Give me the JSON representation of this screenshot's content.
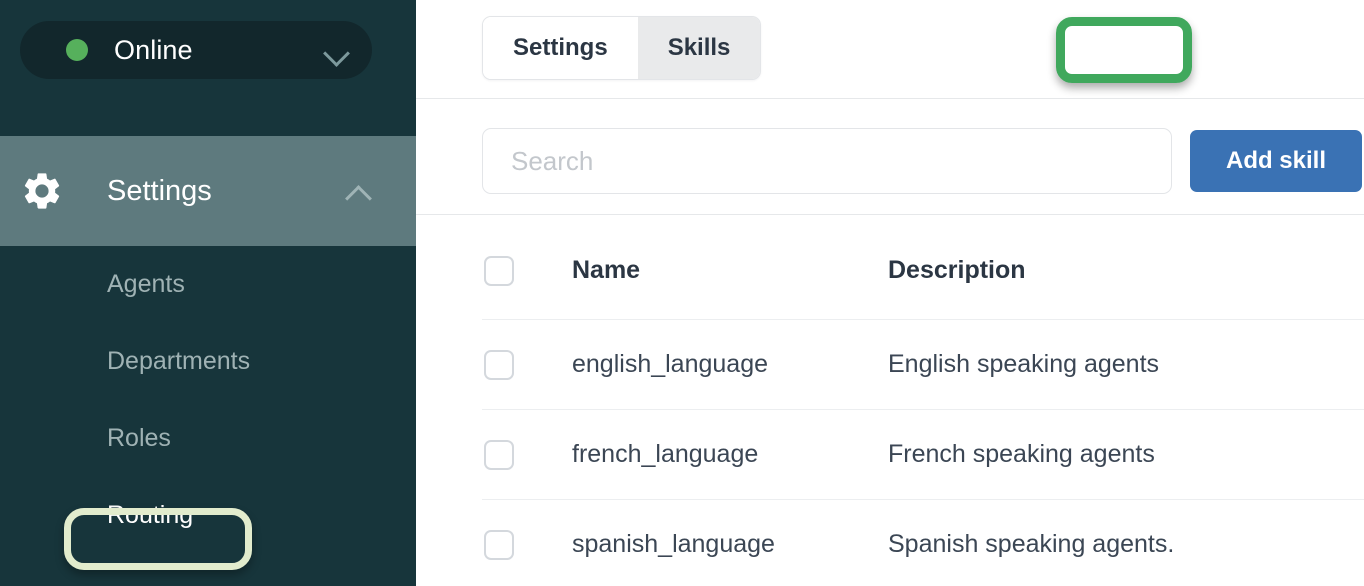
{
  "sidebar": {
    "status": {
      "label": "Online",
      "dot_color": "#56b05c",
      "chevron_icon": "chevron-down-icon"
    },
    "section": {
      "label": "Settings",
      "icon": "gear-icon",
      "chevron_icon": "chevron-up-icon"
    },
    "items": [
      {
        "label": "Agents",
        "active": false
      },
      {
        "label": "Departments",
        "active": false
      },
      {
        "label": "Roles",
        "active": false
      },
      {
        "label": "Routing",
        "active": true
      }
    ]
  },
  "main": {
    "tabs": [
      {
        "label": "Settings",
        "active": false
      },
      {
        "label": "Skills",
        "active": true
      }
    ],
    "search": {
      "placeholder": "Search",
      "value": ""
    },
    "add_button": {
      "label": "Add skill"
    },
    "table": {
      "columns": [
        "Name",
        "Description"
      ],
      "rows": [
        {
          "name": "english_language",
          "description": "English speaking agents"
        },
        {
          "name": "french_language",
          "description": "French speaking agents"
        },
        {
          "name": "spanish_language",
          "description": "Spanish speaking agents."
        }
      ]
    }
  },
  "annotations": {
    "highlight_green": "#40a85d",
    "highlight_cream": "#e2eccd",
    "accent_blue": "#3a72b4",
    "sidebar_bg": "#17353b",
    "sidebar_active_bg": "#5e7a7e"
  }
}
